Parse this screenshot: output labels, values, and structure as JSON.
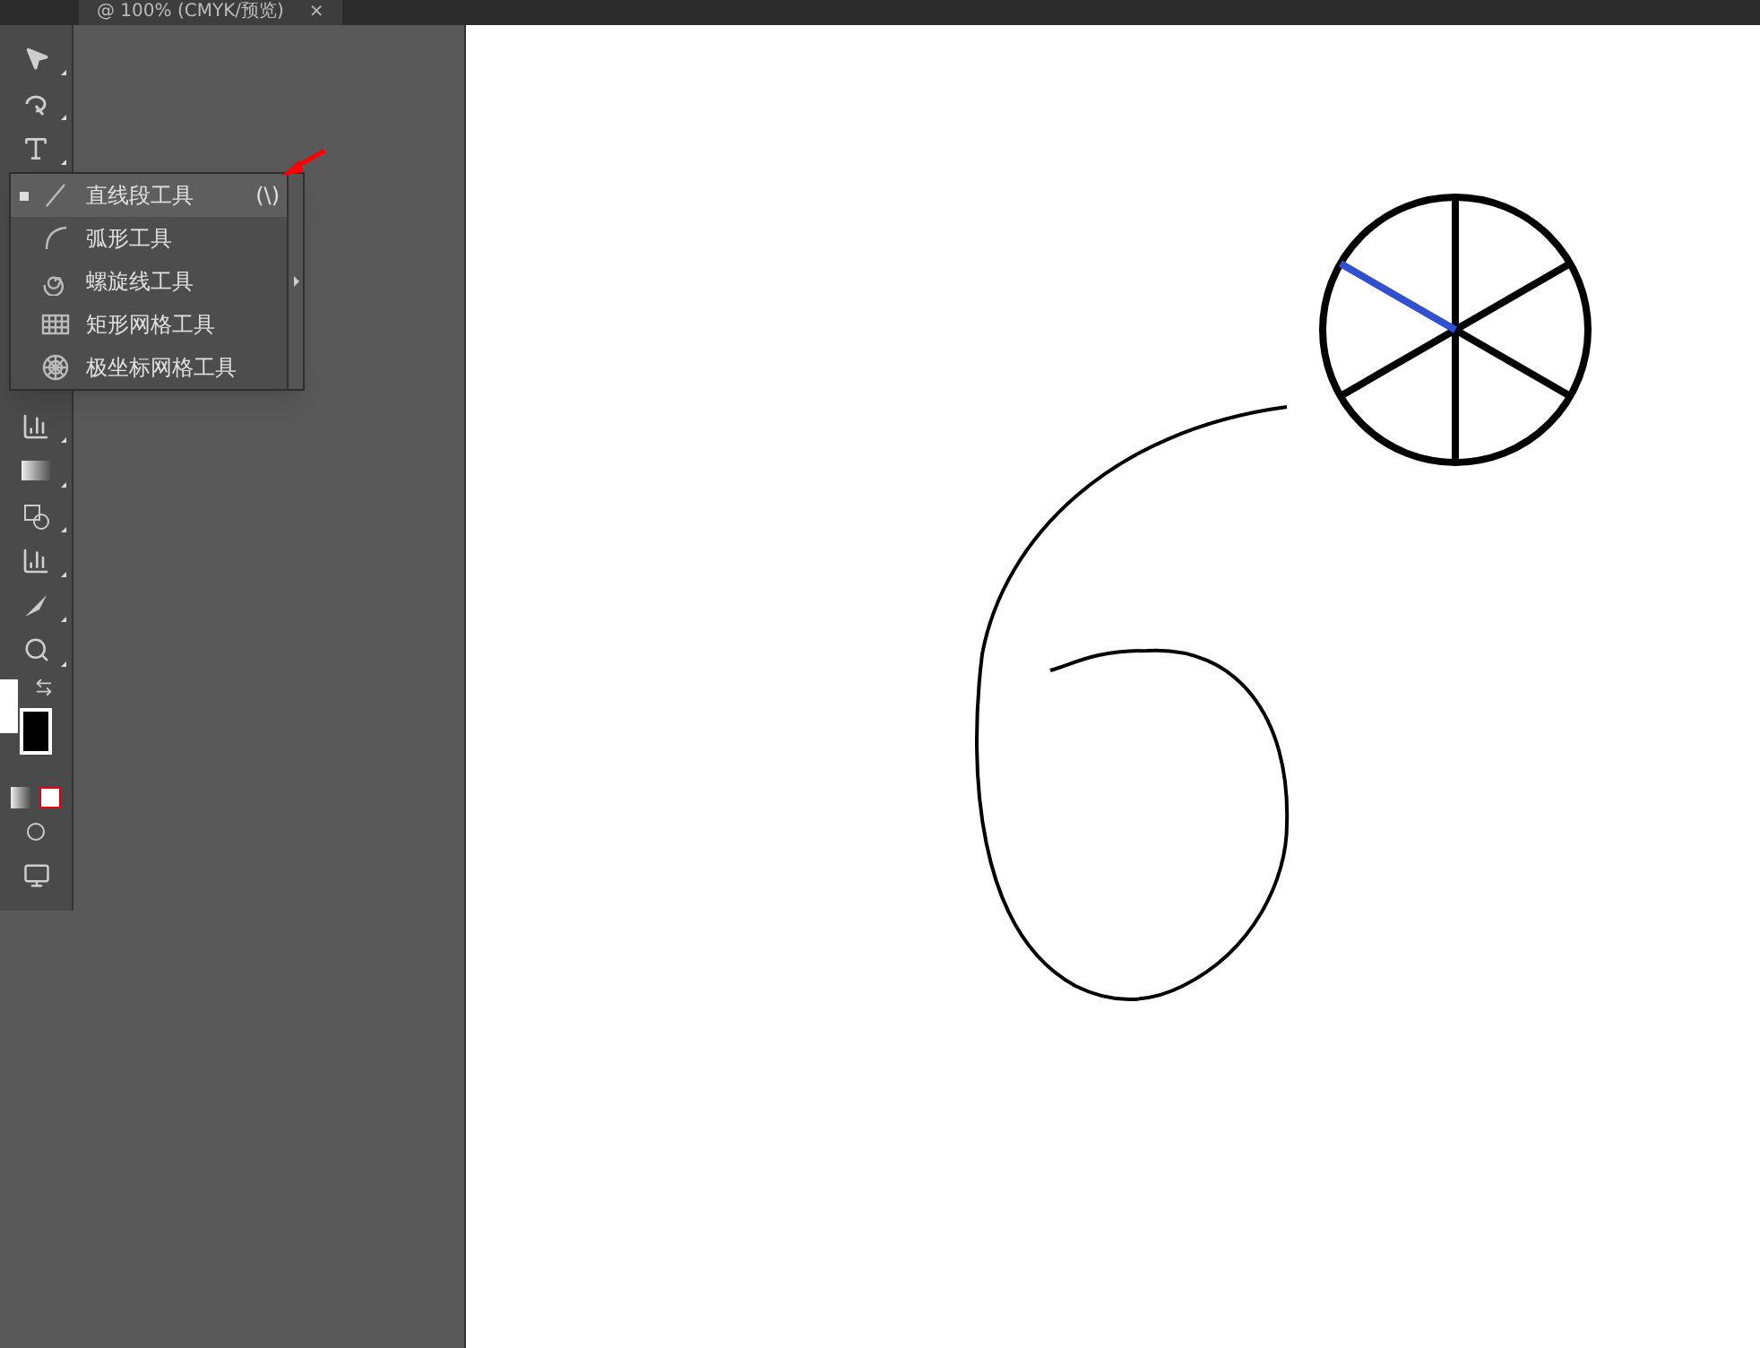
{
  "document_tab": {
    "title": "@ 100% (CMYK/预览)",
    "close": "×"
  },
  "flyout_menu": {
    "items": [
      {
        "kind": "line",
        "label": "直线段工具",
        "shortcut": "(\\)",
        "selected": true
      },
      {
        "kind": "arc",
        "label": "弧形工具",
        "selected": false
      },
      {
        "kind": "spiral",
        "label": "螺旋线工具",
        "selected": false
      },
      {
        "kind": "rect-grid",
        "label": "矩形网格工具",
        "selected": false
      },
      {
        "kind": "polar-grid",
        "label": "极坐标网格工具",
        "selected": false
      }
    ]
  }
}
